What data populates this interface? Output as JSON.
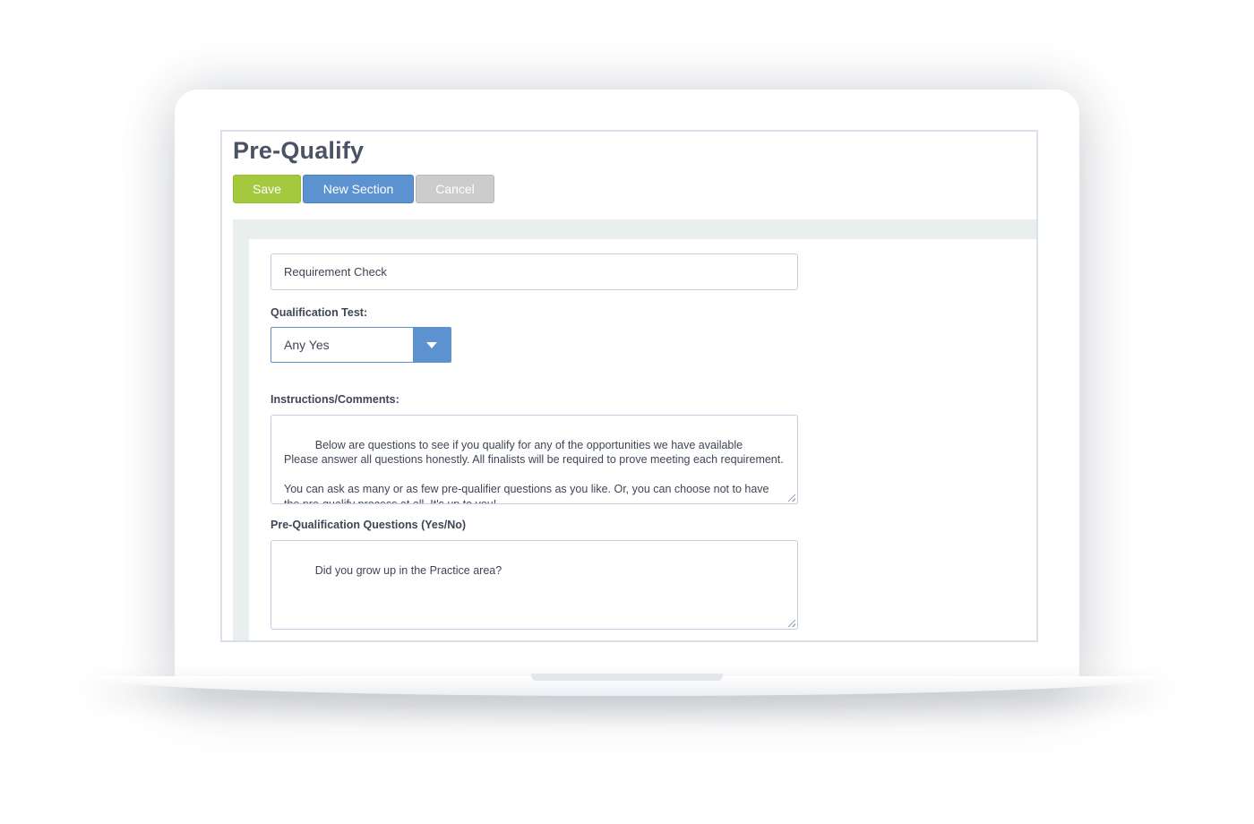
{
  "page": {
    "title": "Pre-Qualify"
  },
  "toolbar": {
    "save_label": "Save",
    "new_section_label": "New Section",
    "cancel_label": "Cancel"
  },
  "colors": {
    "save": "#a5c93e",
    "primary": "#5b92cf",
    "cancel": "#cccccc",
    "panel_bg": "#e9eeef",
    "title_text": "#4a5363"
  },
  "form": {
    "section_name_value": "Requirement Check",
    "qualification_test": {
      "label": "Qualification Test:",
      "selected": "Any Yes",
      "icon": "chevron-down-icon"
    },
    "instructions": {
      "label": "Instructions/Comments:",
      "value": "Below are questions to see if you qualify for any of the opportunities we have available\nPlease answer all questions honestly. All finalists will be required to prove meeting each requirement.\n\nYou can ask as many or as few pre-qualifier questions as you like. Or, you can choose not to have the pre-qualify process at all. It's up to you!"
    },
    "questions": {
      "label": "Pre-Qualification Questions (Yes/No)",
      "value": "Did you grow up in the Practice area?"
    }
  }
}
